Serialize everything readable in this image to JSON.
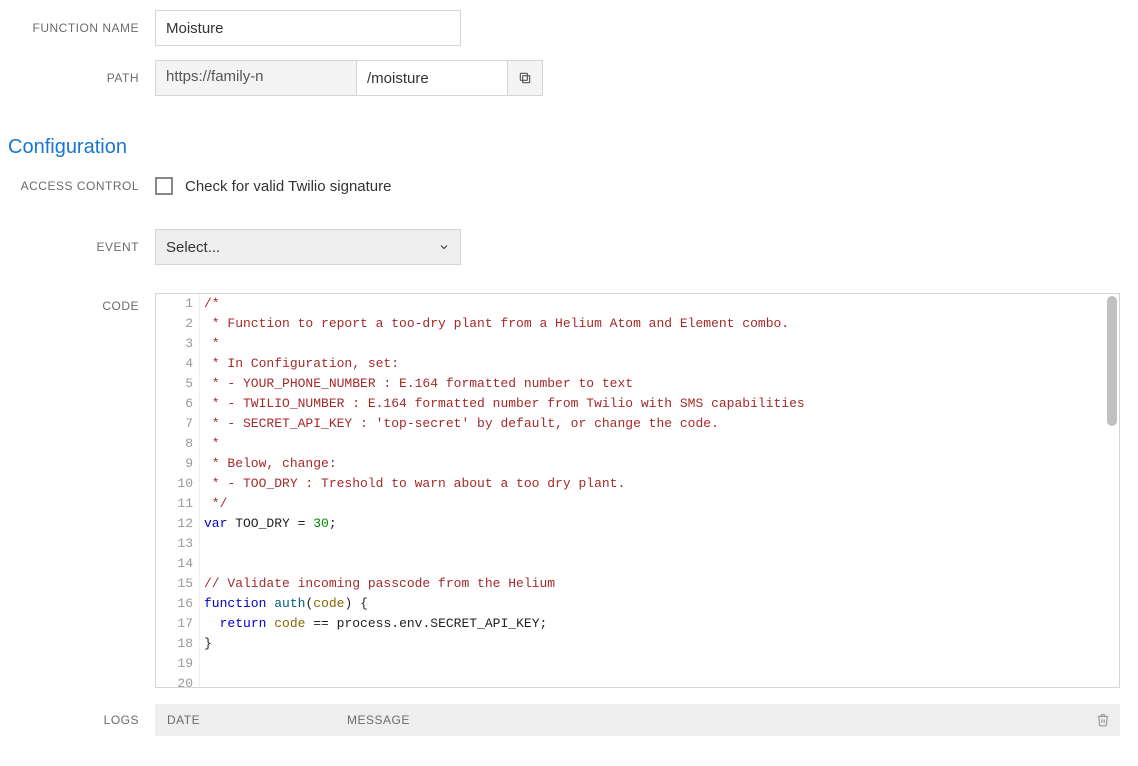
{
  "labels": {
    "function_name": "FUNCTION NAME",
    "path": "PATH",
    "access_control": "ACCESS CONTROL",
    "event": "EVENT",
    "code": "CODE",
    "logs": "LOGS"
  },
  "fields": {
    "function_name_value": "Moisture",
    "path_domain": "https://family-n",
    "path_value": "/moisture",
    "access_control_checkbox_label": "Check for valid Twilio signature",
    "access_control_checked": false,
    "event_selected": "Select..."
  },
  "section_title": "Configuration",
  "logs": {
    "date_col": "DATE",
    "message_col": "MESSAGE"
  },
  "code_lines": [
    {
      "n": 1,
      "tokens": [
        {
          "c": "tok-comment",
          "t": "/*"
        }
      ]
    },
    {
      "n": 2,
      "tokens": [
        {
          "c": "tok-comment",
          "t": " * Function to report a too-dry plant from a Helium Atom and Element combo."
        }
      ]
    },
    {
      "n": 3,
      "tokens": [
        {
          "c": "tok-comment",
          "t": " *"
        }
      ]
    },
    {
      "n": 4,
      "tokens": [
        {
          "c": "tok-comment",
          "t": " * In Configuration, set:"
        }
      ]
    },
    {
      "n": 5,
      "tokens": [
        {
          "c": "tok-comment",
          "t": " * - YOUR_PHONE_NUMBER : E.164 formatted number to text"
        }
      ]
    },
    {
      "n": 6,
      "tokens": [
        {
          "c": "tok-comment",
          "t": " * - TWILIO_NUMBER : E.164 formatted number from Twilio with SMS capabilities"
        }
      ]
    },
    {
      "n": 7,
      "tokens": [
        {
          "c": "tok-comment",
          "t": " * - SECRET_API_KEY : 'top-secret' by default, or change the code."
        }
      ]
    },
    {
      "n": 8,
      "tokens": [
        {
          "c": "tok-comment",
          "t": " *"
        }
      ]
    },
    {
      "n": 9,
      "tokens": [
        {
          "c": "tok-comment",
          "t": " * Below, change:"
        }
      ]
    },
    {
      "n": 10,
      "tokens": [
        {
          "c": "tok-comment",
          "t": " * - TOO_DRY : Treshold to warn about a too dry plant."
        }
      ]
    },
    {
      "n": 11,
      "tokens": [
        {
          "c": "tok-comment",
          "t": " */"
        }
      ]
    },
    {
      "n": 12,
      "tokens": [
        {
          "c": "tok-keyword",
          "t": "var"
        },
        {
          "c": "tok-plain",
          "t": " TOO_DRY "
        },
        {
          "c": "tok-plain",
          "t": "= "
        },
        {
          "c": "tok-num",
          "t": "30"
        },
        {
          "c": "tok-plain",
          "t": ";"
        }
      ]
    },
    {
      "n": 13,
      "tokens": []
    },
    {
      "n": 14,
      "tokens": []
    },
    {
      "n": 15,
      "tokens": [
        {
          "c": "tok-comment",
          "t": "// Validate incoming passcode from the Helium"
        }
      ]
    },
    {
      "n": 16,
      "tokens": [
        {
          "c": "tok-keyword",
          "t": "function"
        },
        {
          "c": "tok-plain",
          "t": " "
        },
        {
          "c": "tok-ident",
          "t": "auth"
        },
        {
          "c": "tok-plain",
          "t": "("
        },
        {
          "c": "tok-builtin",
          "t": "code"
        },
        {
          "c": "tok-plain",
          "t": ") {"
        }
      ]
    },
    {
      "n": 17,
      "tokens": [
        {
          "c": "tok-plain",
          "t": "  "
        },
        {
          "c": "tok-keyword",
          "t": "return"
        },
        {
          "c": "tok-plain",
          "t": " "
        },
        {
          "c": "tok-builtin",
          "t": "code"
        },
        {
          "c": "tok-plain",
          "t": " == process.env.SECRET_API_KEY;"
        }
      ]
    },
    {
      "n": 18,
      "tokens": [
        {
          "c": "tok-plain",
          "t": "}"
        }
      ]
    },
    {
      "n": 19,
      "tokens": []
    },
    {
      "n": 20,
      "tokens": []
    }
  ]
}
